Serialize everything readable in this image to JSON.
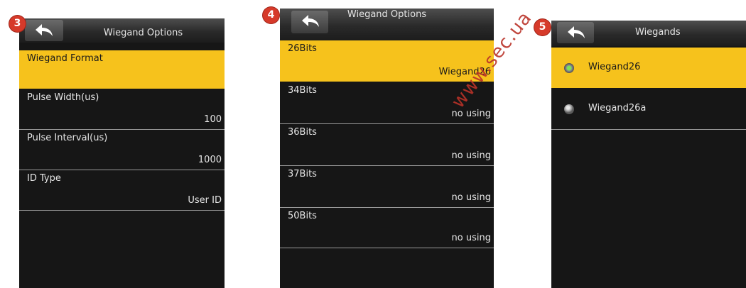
{
  "badges": [
    "3",
    "4",
    "5"
  ],
  "screen3": {
    "title": "Wiegand Options",
    "items": [
      {
        "label": "Wiegand Format",
        "value": ""
      },
      {
        "label": "Pulse Width(us)",
        "value": "100"
      },
      {
        "label": "Pulse Interval(us)",
        "value": "1000"
      },
      {
        "label": "ID Type",
        "value": "User ID"
      }
    ]
  },
  "screen4": {
    "title": "Wiegand Options",
    "items": [
      {
        "label": "26Bits",
        "value": "Wiegand26"
      },
      {
        "label": "34Bits",
        "value": "no using"
      },
      {
        "label": "36Bits",
        "value": "no using"
      },
      {
        "label": "37Bits",
        "value": "no using"
      },
      {
        "label": "50Bits",
        "value": "no using"
      }
    ]
  },
  "screen5": {
    "title": "Wiegands",
    "options": [
      {
        "label": "Wiegand26",
        "selected": true
      },
      {
        "label": "Wiegand26a",
        "selected": false
      }
    ]
  },
  "watermark": "www.sec.ua",
  "colors": {
    "highlight": "#f6c21c",
    "background": "#161616",
    "badge": "#d63a2a"
  }
}
